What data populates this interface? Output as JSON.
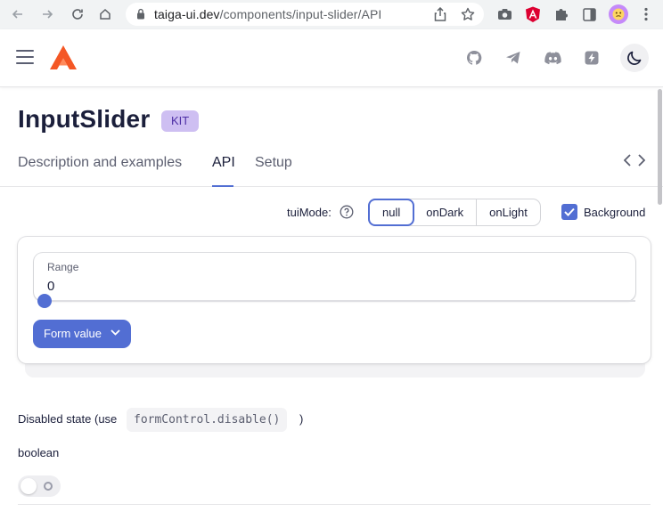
{
  "browser": {
    "url_host": "taiga-ui.dev",
    "url_path": "/components/input-slider/API"
  },
  "page": {
    "title": "InputSlider",
    "badge": "KIT",
    "tabs": [
      {
        "label": "Description and examples",
        "active": false
      },
      {
        "label": "API",
        "active": true
      },
      {
        "label": "Setup",
        "active": false
      }
    ]
  },
  "mode_switch": {
    "label": "tuiMode:",
    "options": [
      "null",
      "onDark",
      "onLight"
    ],
    "selected": "null",
    "background_label": "Background",
    "background_checked": true
  },
  "demo": {
    "field_label": "Range",
    "field_value": "0",
    "slider_fraction": 0,
    "form_value_label": "Form value"
  },
  "docs": {
    "prop_desc": "Disabled state (use",
    "prop_code": "formControl.disable()",
    "prop_close": ")",
    "prop_type": "boolean",
    "toggle_on": false
  },
  "colors": {
    "accent": "#526ed3",
    "badge_bg": "#cebff2",
    "logo": "#f45725"
  }
}
